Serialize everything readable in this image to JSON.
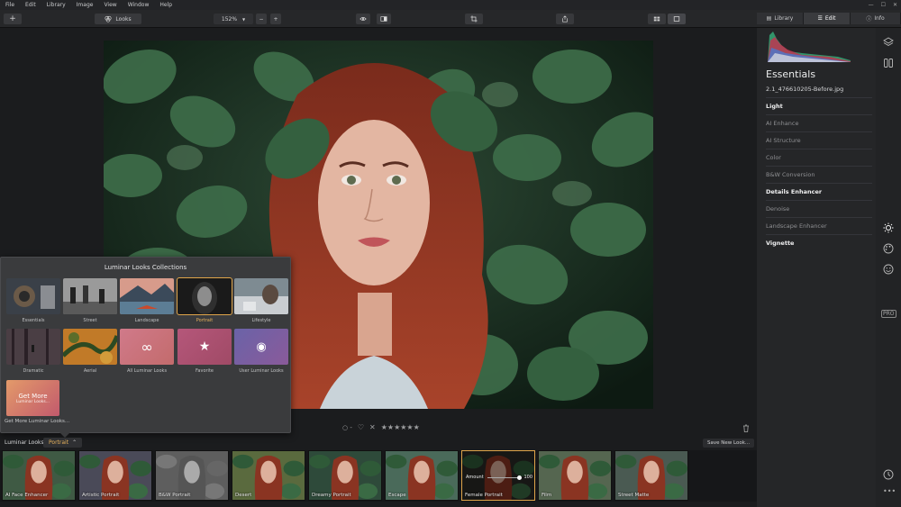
{
  "menu": [
    "File",
    "Edit",
    "Library",
    "Image",
    "View",
    "Window",
    "Help"
  ],
  "toolbar": {
    "add_label": "+",
    "looks_label": "Looks",
    "zoom_value": "152%",
    "zoom_out": "−",
    "zoom_in": "+"
  },
  "right_tabs": [
    {
      "label": "Library",
      "icon": "library-icon"
    },
    {
      "label": "Edit",
      "icon": "sliders-icon"
    },
    {
      "label": "Info",
      "icon": "info-icon"
    }
  ],
  "essentials": {
    "title": "Essentials",
    "filename": "2.1_476610205-Before.jpg",
    "filters": [
      {
        "label": "Light",
        "active": true
      },
      {
        "label": "AI Enhance",
        "active": false
      },
      {
        "label": "AI Structure",
        "active": false
      },
      {
        "label": "Color",
        "active": false
      },
      {
        "label": "B&W Conversion",
        "active": false
      },
      {
        "label": "Details Enhancer",
        "active": true
      },
      {
        "label": "Denoise",
        "active": false
      },
      {
        "label": "Landscape Enhancer",
        "active": false
      },
      {
        "label": "Vignette",
        "active": true
      }
    ]
  },
  "looks_collections": {
    "title": "Luminar Looks Collections",
    "items": [
      {
        "label": "Essentials"
      },
      {
        "label": "Street"
      },
      {
        "label": "Landscape"
      },
      {
        "label": "Portrait"
      },
      {
        "label": "Lifestyle"
      },
      {
        "label": "Dramatic"
      },
      {
        "label": "Aerial"
      },
      {
        "label": "All Luminar Looks"
      },
      {
        "label": "Favorite"
      },
      {
        "label": "User Luminar Looks"
      }
    ],
    "get_more_title": "Get More",
    "get_more_sub": "Luminar Looks...",
    "get_more_link": "Get More Luminar Looks..."
  },
  "rating": {
    "stars": "★★★★★★",
    "flag_reject": "✕",
    "heart": "♡",
    "circle": "○ -"
  },
  "filmbar": {
    "label": "Luminar Looks:",
    "selected_collection": "Portrait",
    "save_button": "Save New Look..."
  },
  "looks": [
    {
      "label": "AI Face Enhancer"
    },
    {
      "label": "Artistic Portrait"
    },
    {
      "label": "B&W Portrait"
    },
    {
      "label": "Desert"
    },
    {
      "label": "Dreamy Portrait"
    },
    {
      "label": "Escape"
    },
    {
      "label": "Female Portrait"
    },
    {
      "label": "Film"
    },
    {
      "label": "Street Matte"
    }
  ],
  "amount": {
    "label": "Amount",
    "value": "100",
    "fraction": 1.0
  },
  "colors": {
    "accent": "#e0a54a",
    "panel": "#252628"
  }
}
